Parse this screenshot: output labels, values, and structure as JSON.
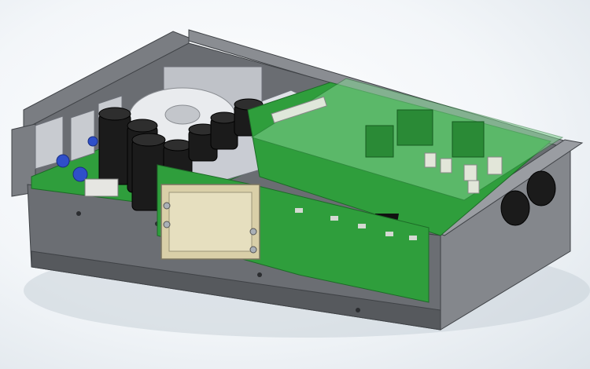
{
  "scene": {
    "subject": "electronics-enclosure-3d-render",
    "colors": {
      "background": "#f2f5f8",
      "chassis": "#5f6266",
      "chassis_dark": "#3f4246",
      "pcb_green": "#2f9e3c",
      "pcb_transparent": "#7fcf8f",
      "capacitor": "#1b1b1b",
      "heatsink": "#c9ccd3",
      "transformer": "#bfc2c8",
      "connector_plate": "#d9cfa8"
    }
  }
}
